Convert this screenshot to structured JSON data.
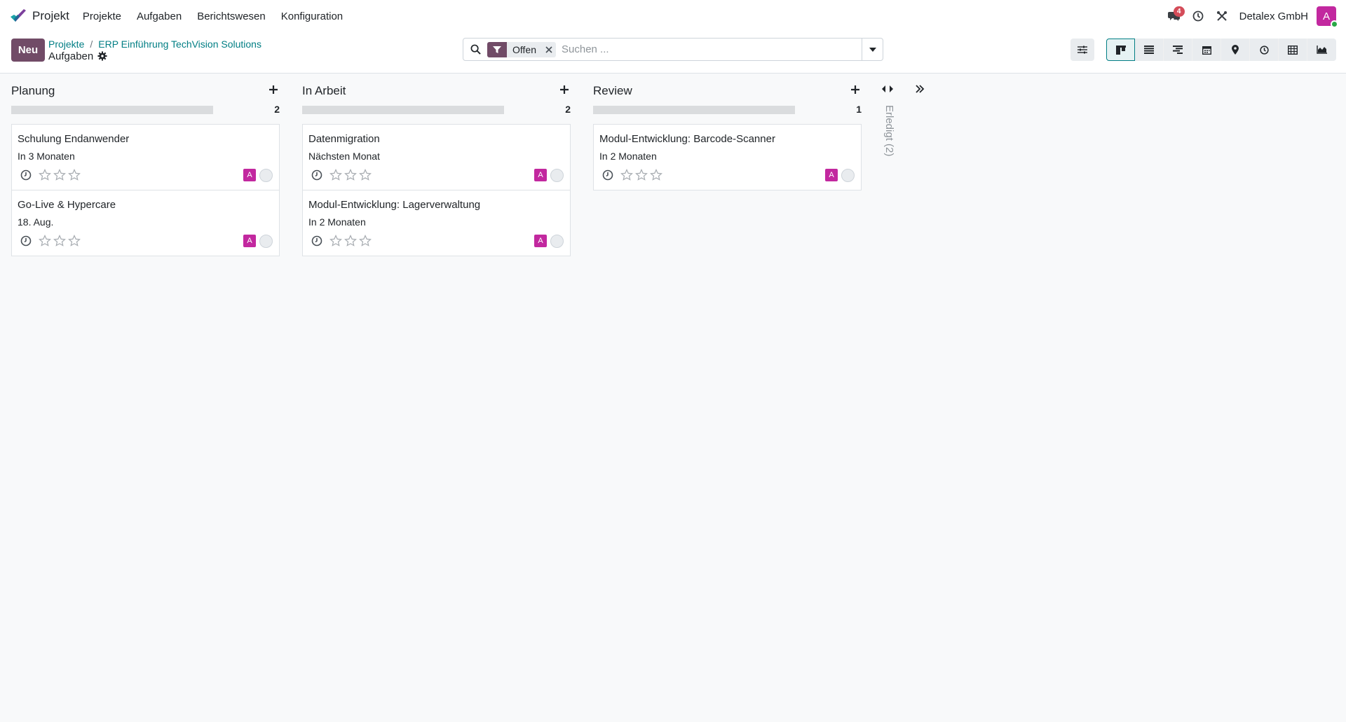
{
  "navbar": {
    "app_name": "Projekt",
    "menu": [
      "Projekte",
      "Aufgaben",
      "Berichtswesen",
      "Konfiguration"
    ],
    "messages_badge": "4",
    "company": "Detalex GmbH",
    "user_initial": "A"
  },
  "control": {
    "new_label": "Neu",
    "breadcrumb": {
      "root": "Projekte",
      "separator": "/",
      "project": "ERP Einführung TechVision Solutions",
      "current": "Aufgaben"
    },
    "search": {
      "facet": "Offen",
      "placeholder": "Suchen ..."
    },
    "views": [
      "kanban",
      "list",
      "gantt",
      "calendar",
      "map",
      "activity",
      "pivot",
      "graph"
    ],
    "active_view": "kanban"
  },
  "colors": {
    "primary": "#714b67",
    "link": "#017e84",
    "avatar": "#c2289f",
    "badge": "#d44c59"
  },
  "kanban": {
    "columns": [
      {
        "title": "Planung",
        "count": "2",
        "cards": [
          {
            "title": "Schulung Endanwender",
            "date": "In 3 Monaten",
            "avatar": "A",
            "priority": 0
          },
          {
            "title": "Go-Live & Hypercare",
            "date": "18. Aug.",
            "avatar": "A",
            "priority": 0
          }
        ]
      },
      {
        "title": "In Arbeit",
        "count": "2",
        "cards": [
          {
            "title": "Datenmigration",
            "date": "Nächsten Monat",
            "avatar": "A",
            "priority": 0
          },
          {
            "title": "Modul-Entwicklung: Lagerverwaltung",
            "date": "In 2 Monaten",
            "avatar": "A",
            "priority": 0
          }
        ]
      },
      {
        "title": "Review",
        "count": "1",
        "cards": [
          {
            "title": "Modul-Entwicklung: Barcode-Scanner",
            "date": "In 2 Monaten",
            "avatar": "A",
            "priority": 0
          }
        ]
      }
    ],
    "folded_column": {
      "label": "Erledigt (2)"
    }
  }
}
